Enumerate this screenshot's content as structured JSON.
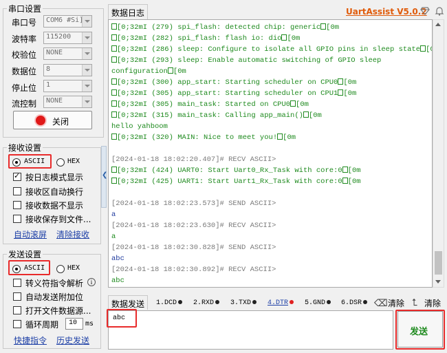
{
  "serial": {
    "title": "串口设置",
    "port_label": "串口号",
    "port_value": "COM6 #Si]",
    "baud_label": "波特率",
    "baud_value": "115200",
    "parity_label": "校验位",
    "parity_value": "NONE",
    "databits_label": "数据位",
    "databits_value": "8",
    "stopbits_label": "停止位",
    "stopbits_value": "1",
    "flow_label": "流控制",
    "flow_value": "NONE",
    "close_button": "关闭"
  },
  "receive": {
    "title": "接收设置",
    "ascii": "ASCII",
    "hex": "HEX",
    "options": [
      "按日志模式显示",
      "接收区自动换行",
      "接收数据不显示",
      "接收保存到文件..."
    ],
    "auto_clear": "自动滚屏",
    "clear_recv": "清除接收"
  },
  "send": {
    "title": "发送设置",
    "ascii": "ASCII",
    "hex": "HEX",
    "options": [
      "转义符指令解析",
      "自动发送附加位",
      "打开文件数据源...",
      "循环周期"
    ],
    "period_value": "10",
    "period_unit": "ms",
    "shortcut": "快捷指令",
    "history": "历史发送"
  },
  "header": {
    "tab": "数据日志",
    "brand": "UartAssist V5.0.2"
  },
  "log": [
    "[0;32mI (279) spi_flash: detected chip: generic",
    "[0;32mI (282) spi_flash: flash io: dio",
    "[0;32mI (286) sleep: Configure to isolate all GPIO pins in sleep state",
    "[0;32mI (293) sleep: Enable automatic switching of GPIO sleep",
    "configuration",
    "[0;32mI (300) app_start: Starting scheduler on CPU0",
    "[0;32mI (305) app_start: Starting scheduler on CPU1",
    "[0;32mI (305) main_task: Started on CPU0",
    "[0;32mI (315) main_task: Calling app_main()",
    "hello yahboom",
    "[0;32mI (320) MAIN: Nice to meet you!",
    "[2024-01-18 18:02:20.407]# RECV ASCII>",
    "[0;32mI (424) UART0: Start Uart0_Rx_Task with core:0",
    "[0;32mI (425) UART1: Start Uart1_Rx_Task with core:0",
    "[2024-01-18 18:02:23.573]# SEND ASCII>",
    "a",
    "[2024-01-18 18:02:23.630]# RECV ASCII>",
    "a",
    "[2024-01-18 18:02:30.828]# SEND ASCII>",
    "abc",
    "[2024-01-18 18:02:30.892]# RECV ASCII>",
    "abc"
  ],
  "sendbar": {
    "tab": "数据发送",
    "signals": [
      "1.DCD",
      "2.RXD",
      "3.TXD",
      "4.DTR",
      "5.GND",
      "6.DSR"
    ],
    "clear1": "清除",
    "clear2": "清除",
    "input_value": "abc",
    "send_button": "发送"
  }
}
